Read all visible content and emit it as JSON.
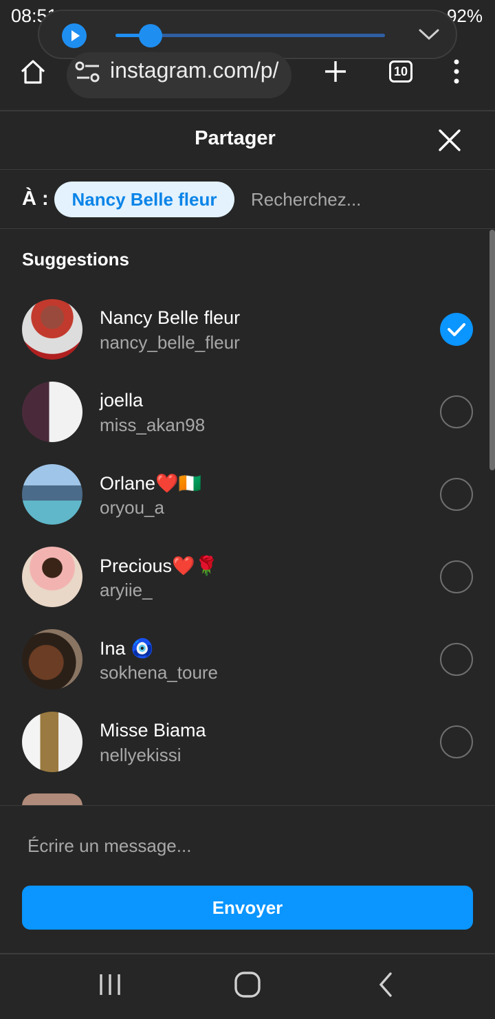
{
  "status_bar": {
    "time": "08:51",
    "battery": "92%"
  },
  "browser": {
    "url": "instagram.com/p/",
    "tab_count": "10"
  },
  "share": {
    "title": "Partager",
    "to_label": "À :",
    "selected_chip": "Nancy Belle fleur",
    "search_placeholder": "Recherchez...",
    "suggestions_title": "Suggestions",
    "suggestions": [
      {
        "name": "Nancy Belle fleur",
        "username": "nancy_belle_fleur",
        "selected": true
      },
      {
        "name": "joella",
        "username": "miss_akan98",
        "selected": false
      },
      {
        "name": "Orlane❤️🇨🇮",
        "username": "oryou_a",
        "selected": false
      },
      {
        "name": "Precious❤️🌹",
        "username": "aryiie_",
        "selected": false
      },
      {
        "name": "Ina 🧿",
        "username": "sokhena_toure",
        "selected": false
      },
      {
        "name": "Misse Biama",
        "username": "nellyekissi",
        "selected": false
      }
    ],
    "message_placeholder": "Écrire un message...",
    "send_label": "Envoyer"
  },
  "colors": {
    "background": "#262626",
    "accent": "#0a95ff",
    "chip_bg": "#e3f2fd",
    "chip_text": "#0a84e8",
    "secondary_text": "#a8a8a8"
  },
  "icons": [
    "play-icon",
    "chevron-down-icon",
    "home-icon",
    "site-settings-icon",
    "plus-icon",
    "tabs-icon",
    "more-vert-icon",
    "close-icon",
    "check-icon",
    "recents-icon",
    "home-nav-icon",
    "back-icon"
  ]
}
